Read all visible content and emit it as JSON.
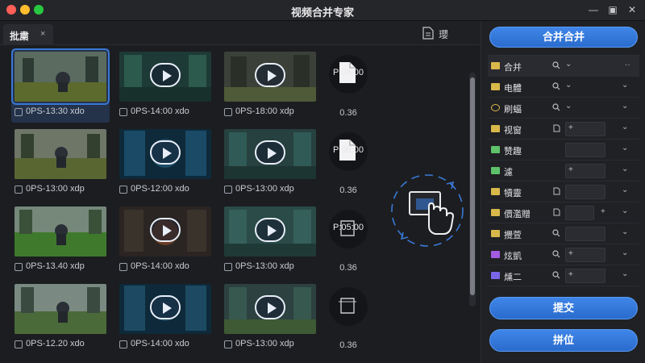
{
  "window": {
    "title": "视频合并专家"
  },
  "tab": {
    "label": "批粛",
    "close": "×"
  },
  "toolbar": {
    "label": "瓔"
  },
  "grid": {
    "videos": [
      {
        "label": "0PS-13:30 xdo"
      },
      {
        "label": "0PS-14:00 xdo"
      },
      {
        "label": "0PS-18:00 xdp"
      },
      {
        "label": "0PS-13:00 xdp"
      },
      {
        "label": "0PS-12:00 xdo"
      },
      {
        "label": "0PS-13:00 xdp"
      },
      {
        "label": "0PS-13.40 xdp"
      },
      {
        "label": "0PS-14:00 xdo"
      },
      {
        "label": "0PS-13:00 xdp"
      },
      {
        "label": "0PS-12.20 xdo"
      },
      {
        "label": "0PS-14:00 xdo"
      },
      {
        "label": "0PS-13:00 xdp"
      }
    ],
    "files": [
      {
        "top": "P:06:00",
        "size": "0.36"
      },
      {
        "top": "P:06:00",
        "size": "0.36"
      },
      {
        "top": "P:05:00",
        "size": "0.36"
      },
      {
        "top": "",
        "size": "0.36"
      }
    ]
  },
  "right": {
    "merge_label": "合并合并",
    "submit_label": "提交",
    "reset_label": "拼位",
    "rows": [
      {
        "label": "合并",
        "icon_color": "#d9b84a",
        "field": "",
        "chev": "⌄",
        "extra": "··"
      },
      {
        "label": "电體",
        "icon_color": "#d9b84a",
        "field": "",
        "chev": "⌄",
        "extra": ""
      },
      {
        "label": "刷蝠",
        "icon_color": "#d9b84a",
        "field": "",
        "chev": "⌄",
        "extra": ""
      },
      {
        "label": "视窗",
        "icon_color": "#d9b84a",
        "field": "+",
        "chev": "⌄",
        "extra": ""
      },
      {
        "label": "赞趣",
        "icon_color": "#5ec26a",
        "field": "",
        "chev": "⌄",
        "extra": ""
      },
      {
        "label": "濾",
        "icon_color": "#5ec26a",
        "field": "+",
        "chev": "⌄",
        "extra": ""
      },
      {
        "label": "犢靈",
        "icon_color": "#d9b84a",
        "field": "",
        "chev": "⌄",
        "extra": ""
      },
      {
        "label": "價濫贈",
        "icon_color": "#d9b84a",
        "field": "",
        "chev": "⌄",
        "extra": "+"
      },
      {
        "label": "攪萱",
        "icon_color": "#d9b84a",
        "field": "",
        "chev": "⌄",
        "extra": ""
      },
      {
        "label": "炫凱",
        "icon_color": "#a35be0",
        "field": "+",
        "chev": "⌄",
        "extra": ""
      },
      {
        "label": "燻二",
        "icon_color": "#7a66e6",
        "field": "+",
        "chev": "⌄",
        "extra": ""
      }
    ]
  },
  "colors": {
    "accent": "#3f86e8",
    "selection": "#3a78d6"
  }
}
